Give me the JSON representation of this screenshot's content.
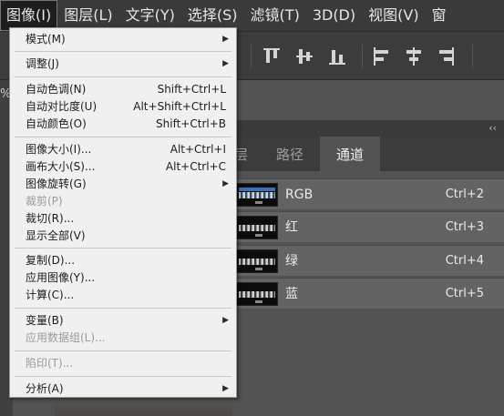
{
  "menubar": {
    "items": [
      {
        "label": "图像(I)",
        "active": true
      },
      {
        "label": "图层(L)"
      },
      {
        "label": "文字(Y)"
      },
      {
        "label": "选择(S)"
      },
      {
        "label": "滤镜(T)"
      },
      {
        "label": "3D(D)"
      },
      {
        "label": "视图(V)"
      },
      {
        "label": "窗"
      }
    ]
  },
  "options_bar": {
    "icons": [
      "align-top-edges-icon",
      "align-vertical-centers-icon",
      "align-bottom-edges-icon",
      "align-left-edges-icon",
      "align-horizontal-centers-icon",
      "align-right-edges-icon"
    ]
  },
  "document": {
    "zoom_fragment": "%"
  },
  "image_menu": {
    "items": [
      {
        "label": "模式(M)",
        "submenu": true
      },
      {
        "label": "调整(J)",
        "submenu": true
      },
      {
        "label": "自动色调(N)",
        "shortcut": "Shift+Ctrl+L"
      },
      {
        "label": "自动对比度(U)",
        "shortcut": "Alt+Shift+Ctrl+L"
      },
      {
        "label": "自动颜色(O)",
        "shortcut": "Shift+Ctrl+B"
      },
      {
        "label": "图像大小(I)...",
        "shortcut": "Alt+Ctrl+I"
      },
      {
        "label": "画布大小(S)...",
        "shortcut": "Alt+Ctrl+C"
      },
      {
        "label": "图像旋转(G)",
        "submenu": true
      },
      {
        "label": "裁剪(P)",
        "disabled": true
      },
      {
        "label": "裁切(R)..."
      },
      {
        "label": "显示全部(V)"
      },
      {
        "label": "复制(D)..."
      },
      {
        "label": "应用图像(Y)..."
      },
      {
        "label": "计算(C)..."
      },
      {
        "label": "变量(B)",
        "submenu": true
      },
      {
        "label": "应用数据组(L)...",
        "disabled": true
      },
      {
        "label": "陷印(T)...",
        "disabled": true
      },
      {
        "label": "分析(A)",
        "submenu": true
      }
    ]
  },
  "panel": {
    "collapse_glyph": "‹‹",
    "tabs": [
      {
        "label": "层"
      },
      {
        "label": "路径"
      },
      {
        "label": "通道",
        "selected": true
      }
    ],
    "channels": [
      {
        "name": "RGB",
        "shortcut": "Ctrl+2"
      },
      {
        "name": "红",
        "shortcut": "Ctrl+3"
      },
      {
        "name": "绿",
        "shortcut": "Ctrl+4"
      },
      {
        "name": "蓝",
        "shortcut": "Ctrl+5"
      }
    ]
  },
  "colors": {
    "menubar_bg": "#3a3a3a",
    "menu_bg": "#f0f0f0",
    "panel_bg": "#535353",
    "channel_row_bg": "#636363"
  }
}
